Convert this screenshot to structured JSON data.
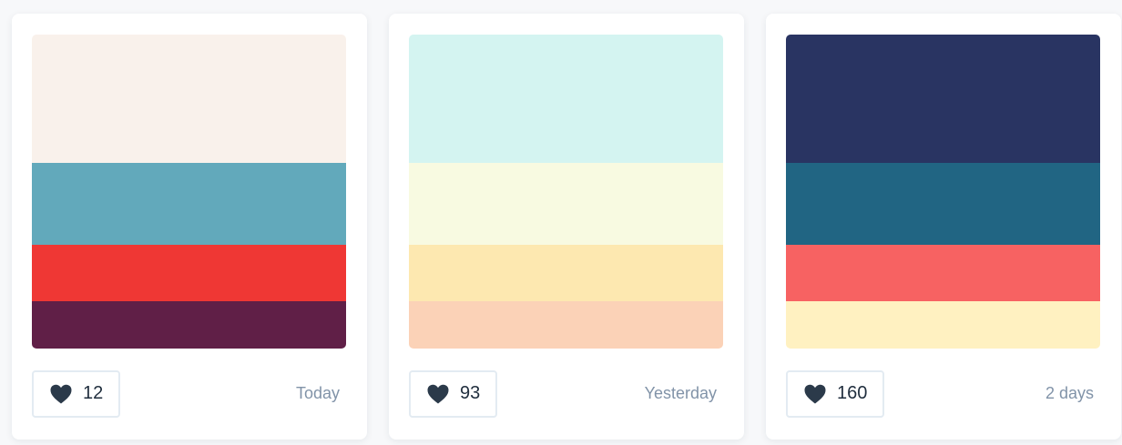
{
  "palettes": [
    {
      "colors": [
        "#f9f1eb",
        "#62a9bb",
        "#ef3734",
        "#601f47"
      ],
      "likes": "12",
      "date": "Today"
    },
    {
      "colors": [
        "#d4f4f1",
        "#f8fae1",
        "#fde8b0",
        "#fbd2b7"
      ],
      "likes": "93",
      "date": "Yesterday"
    },
    {
      "colors": [
        "#293462",
        "#216583",
        "#f76262",
        "#fff1c1"
      ],
      "likes": "160",
      "date": "2 days"
    }
  ],
  "icons": {
    "like": "heart-icon"
  },
  "theme": {
    "heart_color": "#2b3a4a",
    "text_color": "#1f2d3d",
    "muted_text": "#8193a8",
    "border": "#e3ebf2"
  }
}
